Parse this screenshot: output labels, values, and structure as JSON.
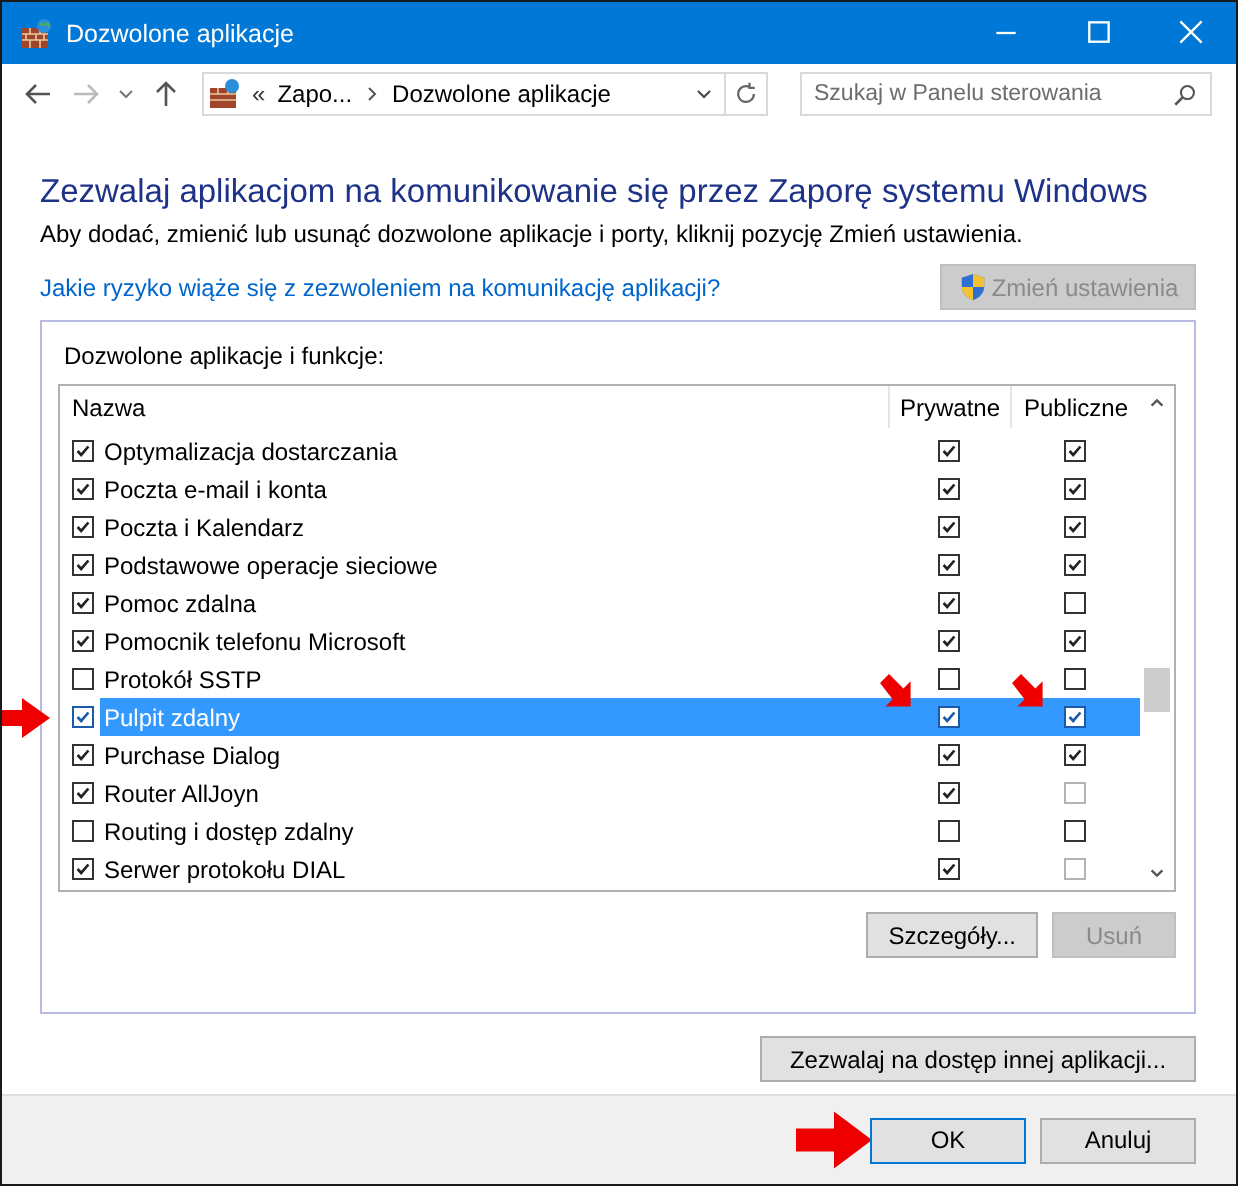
{
  "window": {
    "title": "Dozwolone aplikacje"
  },
  "address_bar": {
    "overflow": "«",
    "crumbs": [
      "Zapo...",
      "Dozwolone aplikacje"
    ]
  },
  "search": {
    "placeholder": "Szukaj w Panelu sterowania"
  },
  "heading": "Zezwalaj aplikacjom na komunikowanie się przez Zaporę systemu Windows",
  "description": "Aby dodać, zmienić lub usunąć dozwolone aplikacje i porty, kliknij pozycję Zmień ustawienia.",
  "risk_link": "Jakie ryzyko wiąże się z zezwoleniem na komunikację aplikacji?",
  "change_settings": {
    "label": "Zmień ustawienia",
    "disabled": true
  },
  "group": {
    "label": "Dozwolone aplikacje i funkcje:"
  },
  "table": {
    "columns": [
      "Nazwa",
      "Prywatne",
      "Publiczne"
    ],
    "rows": [
      {
        "name": "Optymalizacja dostarczania",
        "checked": true,
        "private": true,
        "public": true,
        "public_disabled": false,
        "selected": false
      },
      {
        "name": "Poczta e-mail i konta",
        "checked": true,
        "private": true,
        "public": true,
        "public_disabled": false,
        "selected": false
      },
      {
        "name": "Poczta i Kalendarz",
        "checked": true,
        "private": true,
        "public": true,
        "public_disabled": false,
        "selected": false
      },
      {
        "name": "Podstawowe operacje sieciowe",
        "checked": true,
        "private": true,
        "public": true,
        "public_disabled": false,
        "selected": false
      },
      {
        "name": "Pomoc zdalna",
        "checked": true,
        "private": true,
        "public": false,
        "public_disabled": false,
        "selected": false
      },
      {
        "name": "Pomocnik telefonu Microsoft",
        "checked": true,
        "private": true,
        "public": true,
        "public_disabled": false,
        "selected": false
      },
      {
        "name": "Protokół SSTP",
        "checked": false,
        "private": false,
        "public": false,
        "public_disabled": false,
        "selected": false
      },
      {
        "name": "Pulpit zdalny",
        "checked": true,
        "private": true,
        "public": true,
        "public_disabled": false,
        "selected": true
      },
      {
        "name": "Purchase Dialog",
        "checked": true,
        "private": true,
        "public": true,
        "public_disabled": false,
        "selected": false
      },
      {
        "name": "Router AllJoyn",
        "checked": true,
        "private": true,
        "public": false,
        "public_disabled": true,
        "selected": false
      },
      {
        "name": "Routing i dostęp zdalny",
        "checked": false,
        "private": false,
        "public": false,
        "public_disabled": false,
        "selected": false
      },
      {
        "name": "Serwer protokołu DIAL",
        "checked": true,
        "private": true,
        "public": false,
        "public_disabled": true,
        "selected": false
      }
    ]
  },
  "details_button": {
    "label": "Szczegóły...",
    "disabled": false
  },
  "remove_button": {
    "label": "Usuń",
    "disabled": true
  },
  "allow_other_button": {
    "label": "Zezwalaj na dostęp innej aplikacji..."
  },
  "buttons": [
    "OK",
    "Anuluj"
  ]
}
